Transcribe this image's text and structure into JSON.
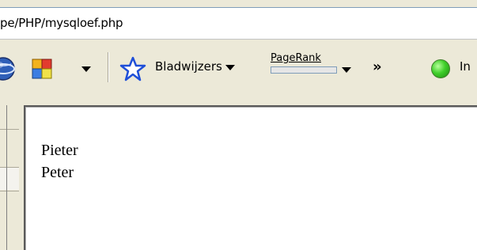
{
  "address_bar": {
    "url": "pe/PHP/mysqloef.php"
  },
  "toolbar": {
    "bookmarks_label": "Bladwijzers",
    "pagerank_label": "PageRank",
    "overflow_label": "»",
    "truncated_label": "In"
  },
  "page": {
    "lines": [
      "Pieter",
      "Peter"
    ]
  }
}
